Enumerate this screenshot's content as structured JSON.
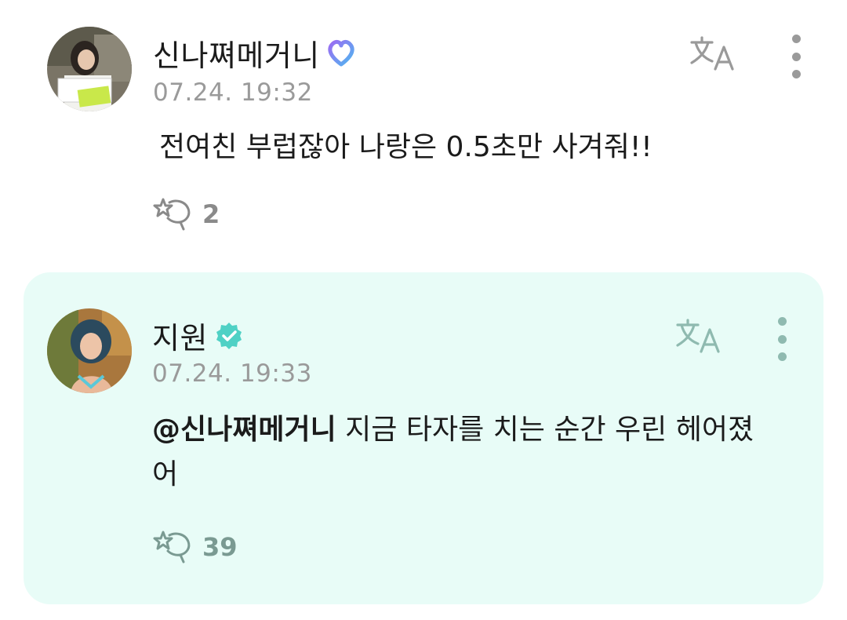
{
  "comments": [
    {
      "author": "신나쪄메거니",
      "badge": "purple-heart-badge",
      "timestamp": "07.24. 19:32",
      "text": "전여친 부럽잖아 나랑은 0.5초만 사겨줘!!",
      "likes": "2",
      "background": "#ffffff"
    },
    {
      "author": "지원",
      "badge": "verified-badge",
      "timestamp": "07.24. 19:33",
      "mention": "@신나쪄메거니",
      "text": " 지금 타자를 치는 순간 우린 헤어졌어",
      "likes": "39",
      "background": "#e8fcf7"
    }
  ],
  "colors": {
    "badge_purple": "#8b7cf0",
    "badge_blue": "#5ec8ec",
    "verified": "#4fd1c5",
    "meta_gray": "#9a9a9a"
  }
}
